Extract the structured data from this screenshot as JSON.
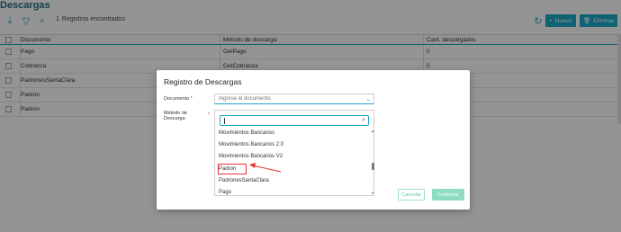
{
  "page": {
    "title": "Descargas",
    "records_count": "1",
    "records_label": "Registros encontrados",
    "btn_new": "Nuevo",
    "btn_delete": "Eliminar",
    "accent_color": "#1ba8c8"
  },
  "table": {
    "headers": [
      "Documento",
      "Método de descarga",
      "Cant. descargados"
    ],
    "rows": [
      {
        "doc": "Pago",
        "method": "GetPago",
        "count": "0"
      },
      {
        "doc": "Cobranza",
        "method": "GetCobranza",
        "count": "0"
      },
      {
        "doc": "PadronesSantaClara",
        "method": "",
        "count": ""
      },
      {
        "doc": "Padron",
        "method": "",
        "count": ""
      },
      {
        "doc": "Padron",
        "method": "",
        "count": ""
      }
    ]
  },
  "modal": {
    "title": "Registro de Descargas",
    "doc_label": "Documento",
    "doc_required": "*",
    "doc_placeholder": "Ingrese el documento",
    "method_label_1": "Método de",
    "method_label_2": "Descarga",
    "method_required": "*",
    "options": [
      "Movimientos Bancarios",
      "Movimientos Bancarios 2.0",
      "Movimientos Bancarios V2",
      "Padron",
      "PadronesSantaClara",
      "Pago"
    ],
    "highlighted_option": "Padron",
    "btn_cancel": "Cancelar",
    "btn_confirm": "Confirmar",
    "highlight_color": "#e53333"
  }
}
